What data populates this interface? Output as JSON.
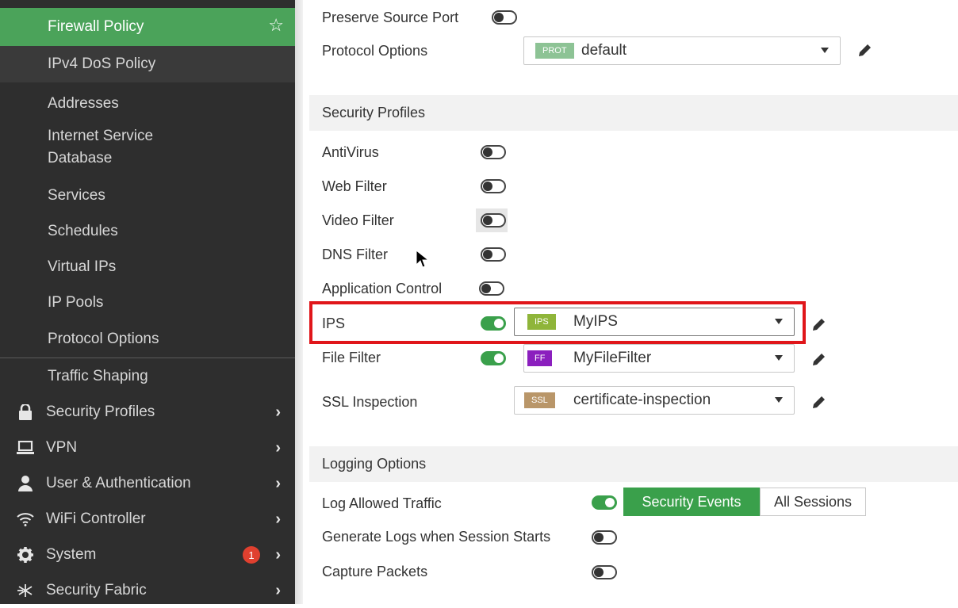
{
  "sidebar": {
    "items": [
      {
        "label": "Firewall Policy",
        "selected": true
      },
      {
        "label": "IPv4 DoS Policy"
      },
      {
        "label": "Addresses"
      },
      {
        "label": "Internet Service"
      },
      {
        "label": "Database"
      },
      {
        "label": "Services"
      },
      {
        "label": "Schedules"
      },
      {
        "label": "Virtual IPs"
      },
      {
        "label": "IP Pools"
      },
      {
        "label": "Protocol Options"
      },
      {
        "label": "Traffic Shaping"
      }
    ],
    "sections": [
      {
        "label": "Security Profiles",
        "icon": "lock-icon"
      },
      {
        "label": "VPN",
        "icon": "laptop-icon"
      },
      {
        "label": "User & Authentication",
        "icon": "user-icon"
      },
      {
        "label": "WiFi Controller",
        "icon": "wifi-icon"
      },
      {
        "label": "System",
        "icon": "gear-icon",
        "badge": "1"
      },
      {
        "label": "Security Fabric",
        "icon": "fabric-icon"
      }
    ]
  },
  "top": {
    "preserve_source_port": {
      "label": "Preserve Source Port",
      "on": false
    },
    "protocol_options": {
      "label": "Protocol Options",
      "tag": "PROT",
      "value": "default"
    }
  },
  "security_profiles": {
    "title": "Security Profiles",
    "antivirus": {
      "label": "AntiVirus",
      "on": false
    },
    "web_filter": {
      "label": "Web Filter",
      "on": false
    },
    "video_filter": {
      "label": "Video Filter",
      "on": false
    },
    "dns_filter": {
      "label": "DNS Filter",
      "on": false
    },
    "application_control": {
      "label": "Application Control",
      "on": false
    },
    "ips": {
      "label": "IPS",
      "on": true,
      "tag": "IPS",
      "value": "MyIPS"
    },
    "file_filter": {
      "label": "File Filter",
      "on": true,
      "tag": "FF",
      "value": "MyFileFilter"
    },
    "ssl_inspection": {
      "label": "SSL Inspection",
      "tag": "SSL",
      "value": "certificate-inspection"
    }
  },
  "logging": {
    "title": "Logging Options",
    "log_allowed": {
      "label": "Log Allowed Traffic",
      "on": true
    },
    "security_events": "Security Events",
    "all_sessions": "All Sessions",
    "generate_logs": {
      "label": "Generate Logs when Session Starts",
      "on": false
    },
    "capture_packets": {
      "label": "Capture Packets",
      "on": false
    }
  },
  "colors": {
    "accent_green": "#4ba35a",
    "toggle_on": "#3aa04b",
    "highlight_red": "#e0161a",
    "tag_prot": "#8dc395",
    "tag_ips": "#8fb53a",
    "tag_ff": "#8b1fbe",
    "tag_ssl": "#b99669"
  }
}
